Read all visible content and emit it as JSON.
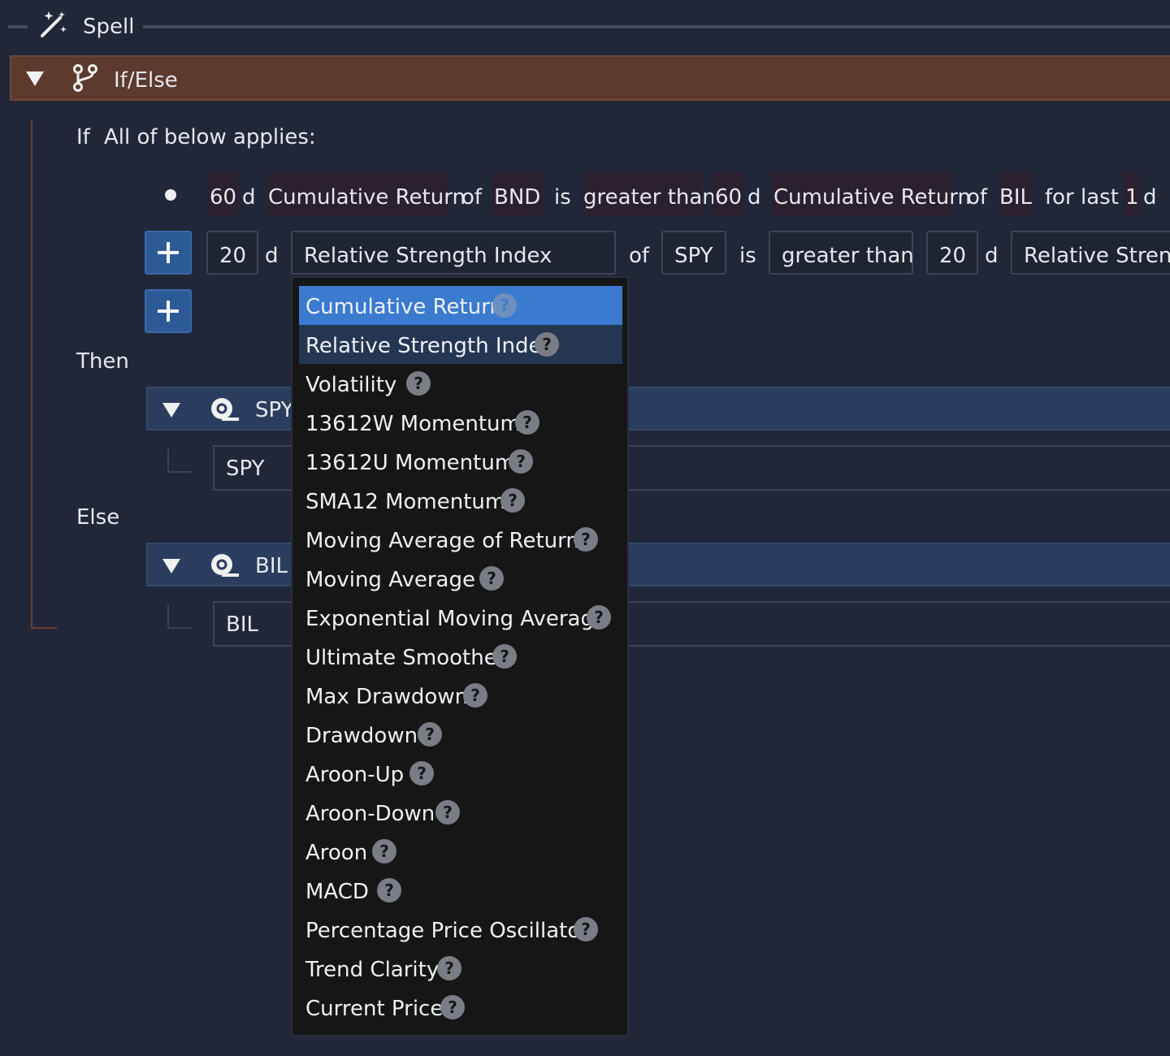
{
  "spell": {
    "label": "Spell"
  },
  "ifelse": {
    "label": "If/Else"
  },
  "condition": {
    "if_label": "If",
    "applies_label": "All of below applies:",
    "rule1": {
      "period1": "60",
      "unit1": "d",
      "metric1": "Cumulative Return",
      "of1": "of",
      "asset1": "BND",
      "is": "is",
      "comparator": "greater than",
      "period2": "60",
      "unit2": "d",
      "metric2": "Cumulative Return",
      "of2": "of",
      "asset2": "BIL",
      "for_last": "for last",
      "duration": "1",
      "duration_unit": "d"
    },
    "rule2": {
      "period1": "20",
      "unit1": "d",
      "metric1": "Relative Strength Index",
      "of1": "of",
      "asset1": "SPY",
      "is": "is",
      "comparator": "greater than",
      "period2": "20",
      "unit2": "d",
      "metric2": "Relative Streng"
    }
  },
  "then_label": "Then",
  "else_label": "Else",
  "then_asset": {
    "header": "SPY",
    "ticker": "SPY"
  },
  "else_asset": {
    "header": "BIL",
    "ticker": "BIL"
  },
  "dropdown": {
    "help_glyph": "?",
    "items": [
      "Cumulative Return",
      "Relative Strength Index",
      "Volatility",
      "13612W Momentum",
      "13612U Momentum",
      "SMA12 Momentum",
      "Moving Average of Returns",
      "Moving Average",
      "Exponential Moving Average",
      "Ultimate Smoother",
      "Max Drawdown",
      "Drawdown",
      "Aroon-Up",
      "Aroon-Down",
      "Aroon",
      "MACD",
      "Percentage Price Oscillator",
      "Trend Clarity",
      "Current Price"
    ]
  },
  "colors": {
    "background": "#212739",
    "ifelse_bar": "#5d3a2d",
    "plus_button": "#2c5a97",
    "dropdown_selected": "#3a7bd0",
    "dropdown_hover": "#253653",
    "asset_bar": "#2a3d5e"
  }
}
